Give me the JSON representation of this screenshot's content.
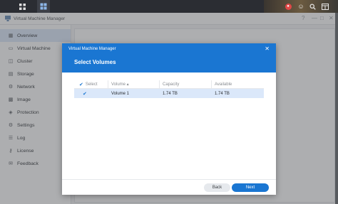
{
  "window": {
    "title": "Virtual Machine Manager"
  },
  "sidebar": {
    "items": [
      {
        "label": "Overview",
        "icon": "overview-icon",
        "active": true
      },
      {
        "label": "Virtual Machine",
        "icon": "virtual-machine-icon"
      },
      {
        "label": "Cluster",
        "icon": "cluster-icon"
      },
      {
        "label": "Storage",
        "icon": "storage-icon"
      },
      {
        "label": "Network",
        "icon": "network-icon"
      },
      {
        "label": "Image",
        "icon": "image-icon"
      },
      {
        "label": "Protection",
        "icon": "protection-icon"
      },
      {
        "label": "Settings",
        "icon": "settings-icon"
      },
      {
        "label": "Log",
        "icon": "log-icon"
      },
      {
        "label": "License",
        "icon": "license-icon"
      },
      {
        "label": "Feedback",
        "icon": "feedback-icon"
      }
    ]
  },
  "dialog": {
    "app_title": "Virtual Machine Manager",
    "title": "Select Volumes",
    "columns": {
      "select": "Select",
      "volume": "Volume ▴",
      "capacity": "Capacity",
      "available": "Available"
    },
    "rows": [
      {
        "selected": true,
        "volume": "Volume 1",
        "capacity": "1.74 TB",
        "available": "1.74 TB"
      }
    ],
    "back_label": "Back",
    "next_label": "Next"
  },
  "colors": {
    "accent": "#1a76d2",
    "selected_row": "#dbe8fa",
    "taskbar": "#2b2d33"
  }
}
